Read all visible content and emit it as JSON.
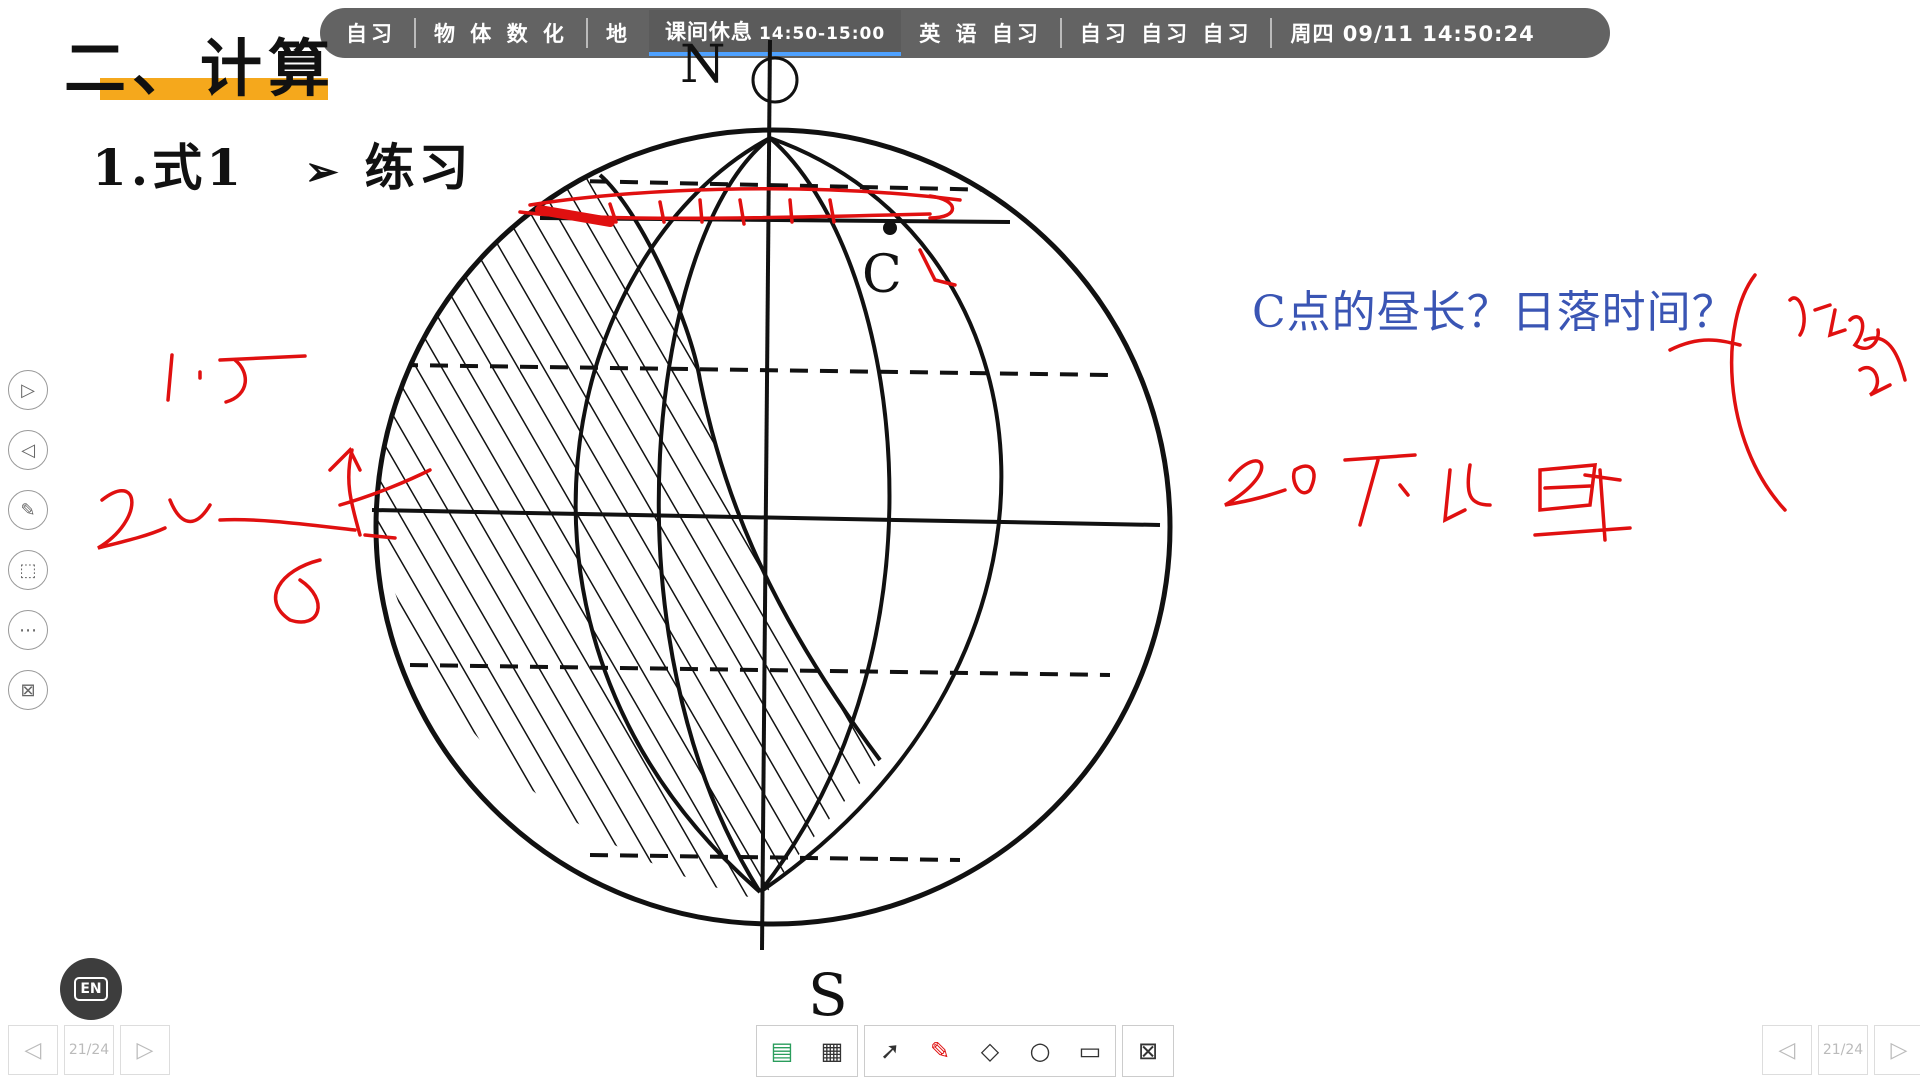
{
  "topbar": {
    "slots_before": [
      "自习",
      "物 体 数 化",
      "地"
    ],
    "current_label": "课间休息",
    "current_time": "14:50-15:00",
    "slots_after_a": "英 语 自习",
    "slots_after_b": "自习 自习 自习",
    "clock": "周四 09/11  14:50:24"
  },
  "slide": {
    "title": "二、计算",
    "subtitle": "1.式1",
    "arrow": "➢",
    "practice": "练习",
    "question": "C点的昼长？日落时间？",
    "north": "N",
    "south": "S",
    "point_c": "C"
  },
  "pager": {
    "left_page": "21/24",
    "right_page": "21/24"
  },
  "colors": {
    "accent_bar": "#f5a81c",
    "question": "#3a55b4",
    "ink": "#e01010"
  },
  "icons": {
    "left_toolbar": [
      "play-icon",
      "back-icon",
      "pen-icon",
      "screen-select-icon",
      "more-icon",
      "exit-screen-icon"
    ],
    "bottom_toolbar": [
      "book-icon",
      "apps-icon",
      "cursor-icon",
      "pen-icon",
      "eraser-icon",
      "search-icon",
      "board-icon",
      "close-board-icon"
    ]
  }
}
